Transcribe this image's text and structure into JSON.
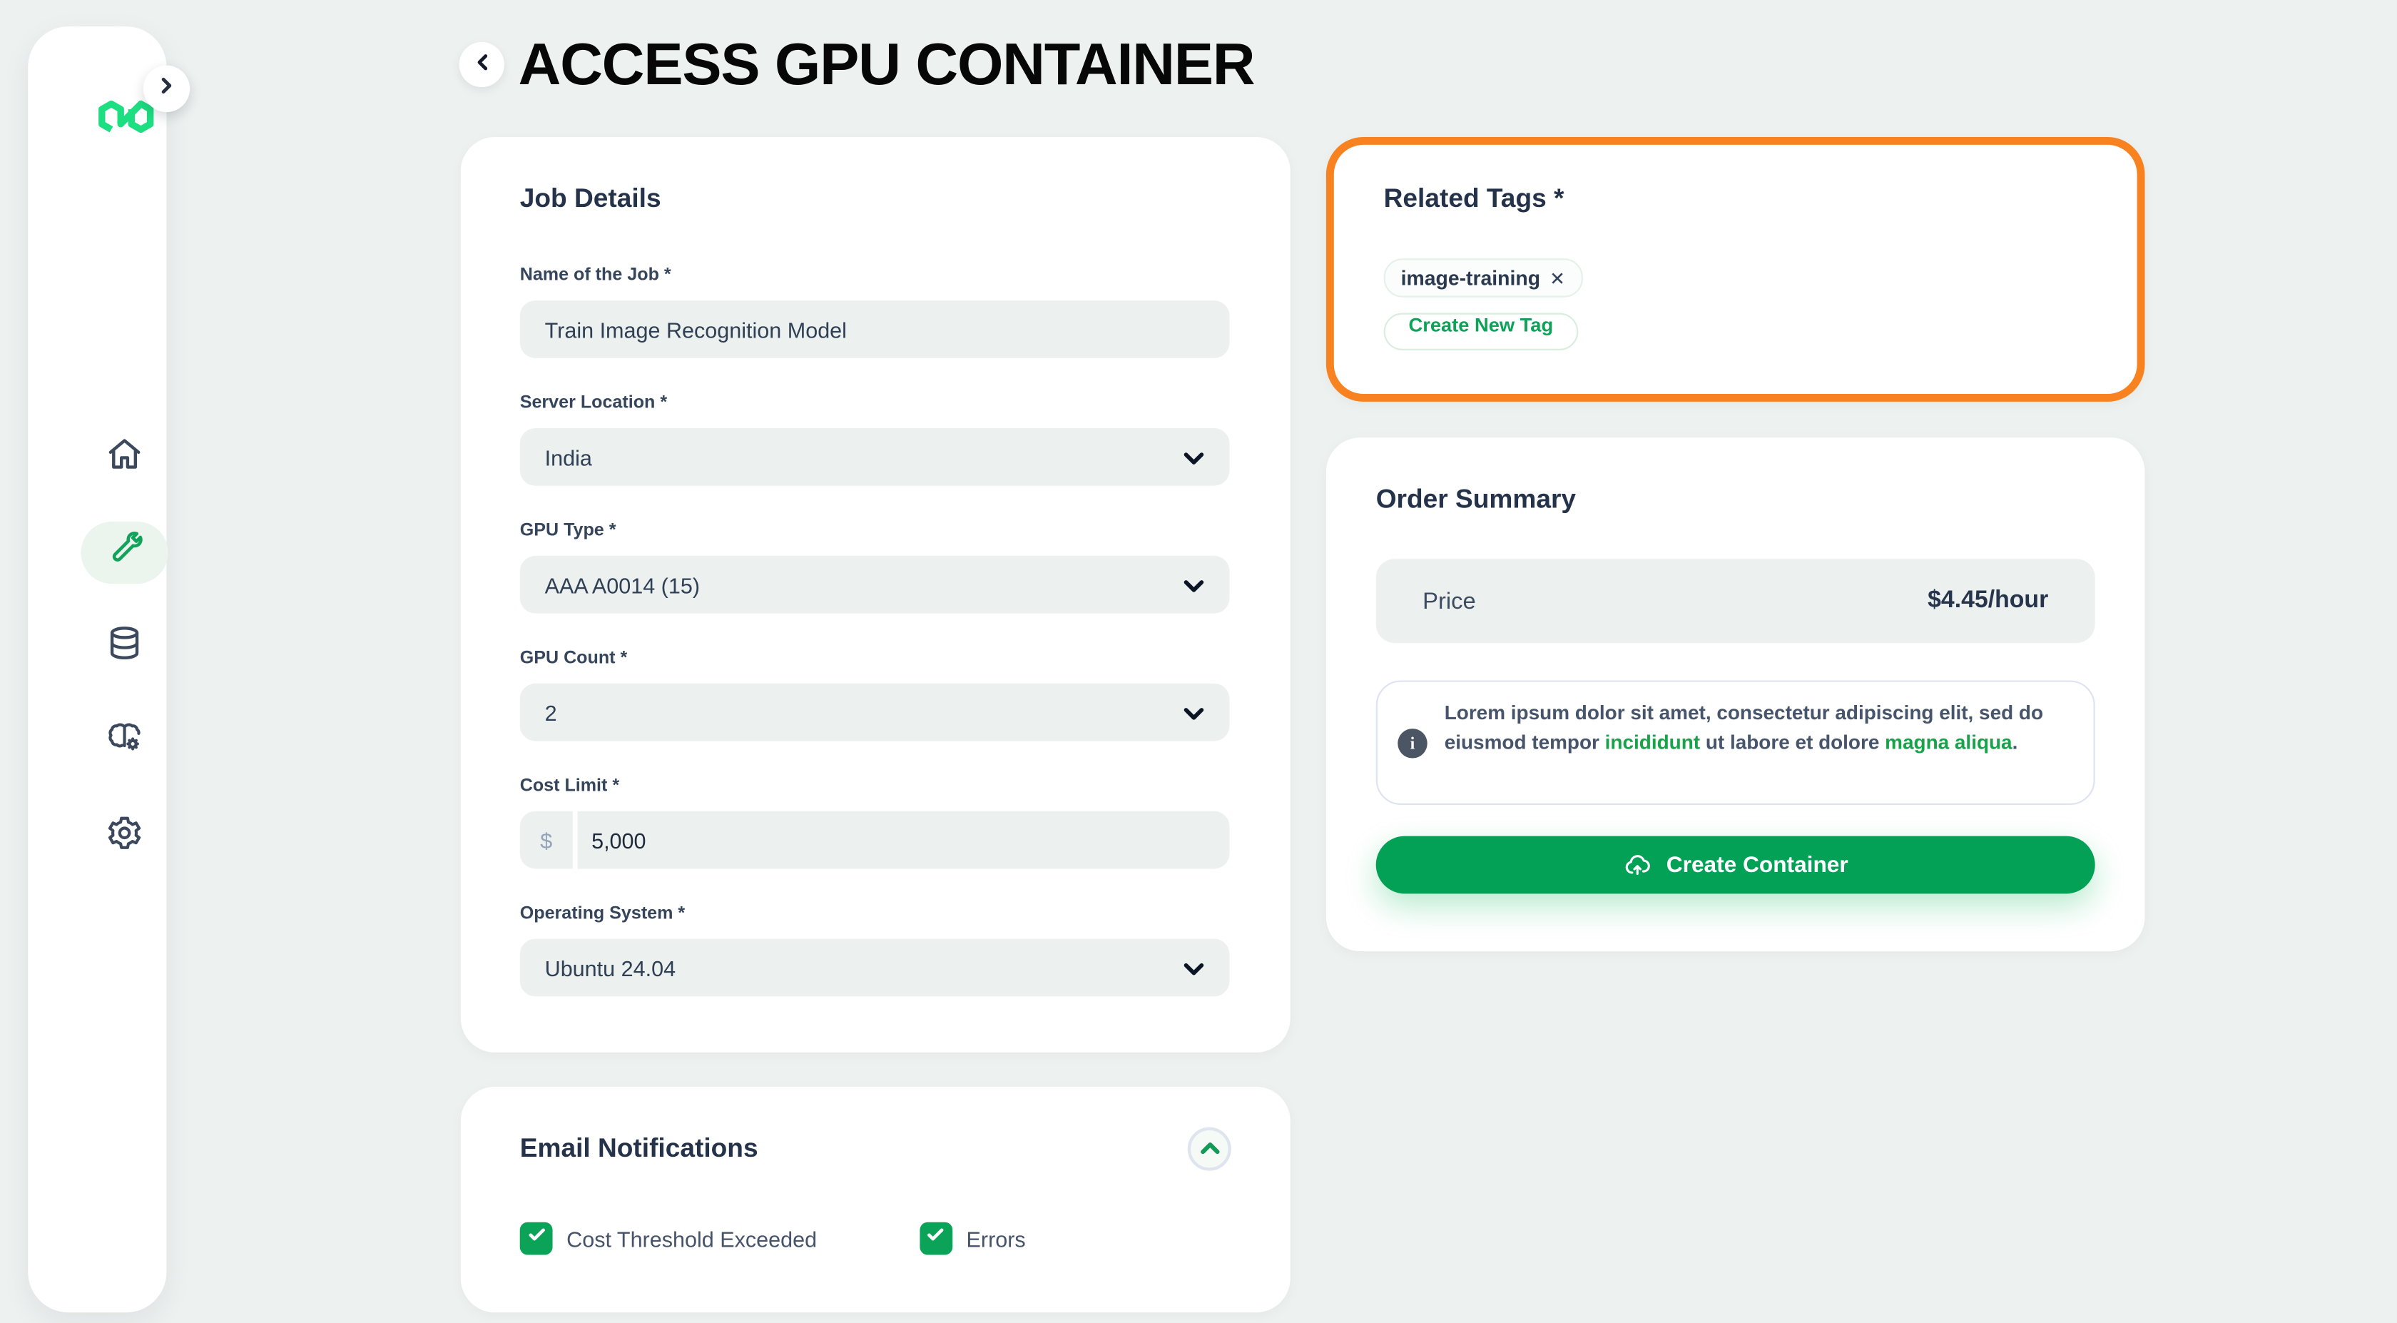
{
  "header": {
    "title": "ACCESS GPU CONTAINER",
    "back_icon": "chevron-left"
  },
  "sidebar": {
    "logo_icon": "infinity-logo",
    "expand_icon": "chevron-right",
    "items": [
      {
        "icon": "home-icon",
        "active": false
      },
      {
        "icon": "wrench-icon",
        "active": true
      },
      {
        "icon": "database-icon",
        "active": false
      },
      {
        "icon": "brain-gear-icon",
        "active": false
      },
      {
        "icon": "gear-icon",
        "active": false
      }
    ]
  },
  "job_details": {
    "heading": "Job Details",
    "fields": [
      {
        "label": "Name of the Job *",
        "value": "Train Image Recognition Model",
        "type": "text"
      },
      {
        "label": "Server Location *",
        "value": "India",
        "type": "select"
      },
      {
        "label": "GPU Type *",
        "value": "AAA A0014 (15)",
        "type": "select"
      },
      {
        "label": "GPU Count *",
        "value": "2",
        "type": "select"
      },
      {
        "label": "Cost Limit *",
        "prefix": "$",
        "value": "5,000",
        "type": "currency"
      },
      {
        "label": "Operating System *",
        "value": "Ubuntu 24.04",
        "type": "select"
      }
    ]
  },
  "email_notifications": {
    "heading": "Email Notifications",
    "collapse_icon": "chevron-up",
    "checkboxes": [
      {
        "label": "Cost Threshold Exceeded",
        "checked": true
      },
      {
        "label": "Errors",
        "checked": true
      }
    ]
  },
  "related_tags": {
    "heading": "Related Tags *",
    "tags": [
      {
        "label": "image-training",
        "remove_icon": "x-icon"
      }
    ],
    "create_button_label": "Create New Tag",
    "highlight_color": "#F8821F"
  },
  "order_summary": {
    "heading": "Order Summary",
    "price_label": "Price",
    "price_value": "$4.45/hour",
    "note_parts": [
      {
        "t": "Lorem ipsum dolor sit amet, consectetur adipiscing elit, sed do eiusmod tempor ",
        "green": false
      },
      {
        "t": "incididunt",
        "green": true
      },
      {
        "t": " ut labore et dolore ",
        "green": false
      },
      {
        "t": "magna aliqua",
        "green": true
      },
      {
        "t": ".",
        "green": false
      }
    ],
    "cta_label": "Create Container",
    "cta_icon": "cloud-upload-icon"
  },
  "colors": {
    "accent_green": "#02A155",
    "checkbox_green": "#0AA357",
    "logo_green": "#1EDE82",
    "highlight_orange": "#F8821F",
    "icon_slate": "#3C485C",
    "page_bg": "#EDF1F0"
  }
}
